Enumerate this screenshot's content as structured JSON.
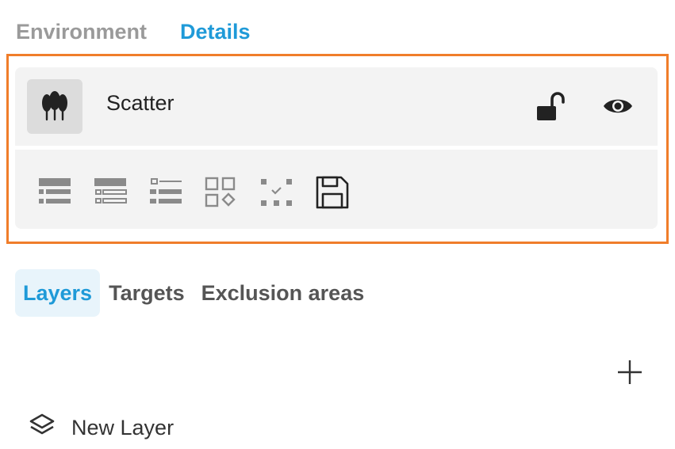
{
  "top_tabs": [
    {
      "label": "Environment",
      "active": false
    },
    {
      "label": "Details",
      "active": true
    }
  ],
  "layer_card": {
    "name": "Scatter",
    "type_icon": "trees-icon",
    "lock_icon": "unlocked-padlock-icon",
    "visibility_icon": "eye-icon",
    "tools": [
      {
        "name": "layout-list-icon"
      },
      {
        "name": "bulleted-list-icon"
      },
      {
        "name": "checklist-icon"
      },
      {
        "name": "grid-shapes-icon"
      },
      {
        "name": "selection-icon"
      },
      {
        "name": "save-icon"
      }
    ]
  },
  "sub_tabs": [
    {
      "label": "Layers",
      "active": true
    },
    {
      "label": "Targets",
      "active": false
    },
    {
      "label": "Exclusion areas",
      "active": false
    }
  ],
  "add_icon": "plus-icon",
  "layers": [
    {
      "label": "New Layer",
      "icon": "layers-icon"
    }
  ],
  "colors": {
    "accent": "#1f9ad8",
    "highlight_border": "#f07d2a",
    "panel_bg": "#f3f3f3"
  }
}
